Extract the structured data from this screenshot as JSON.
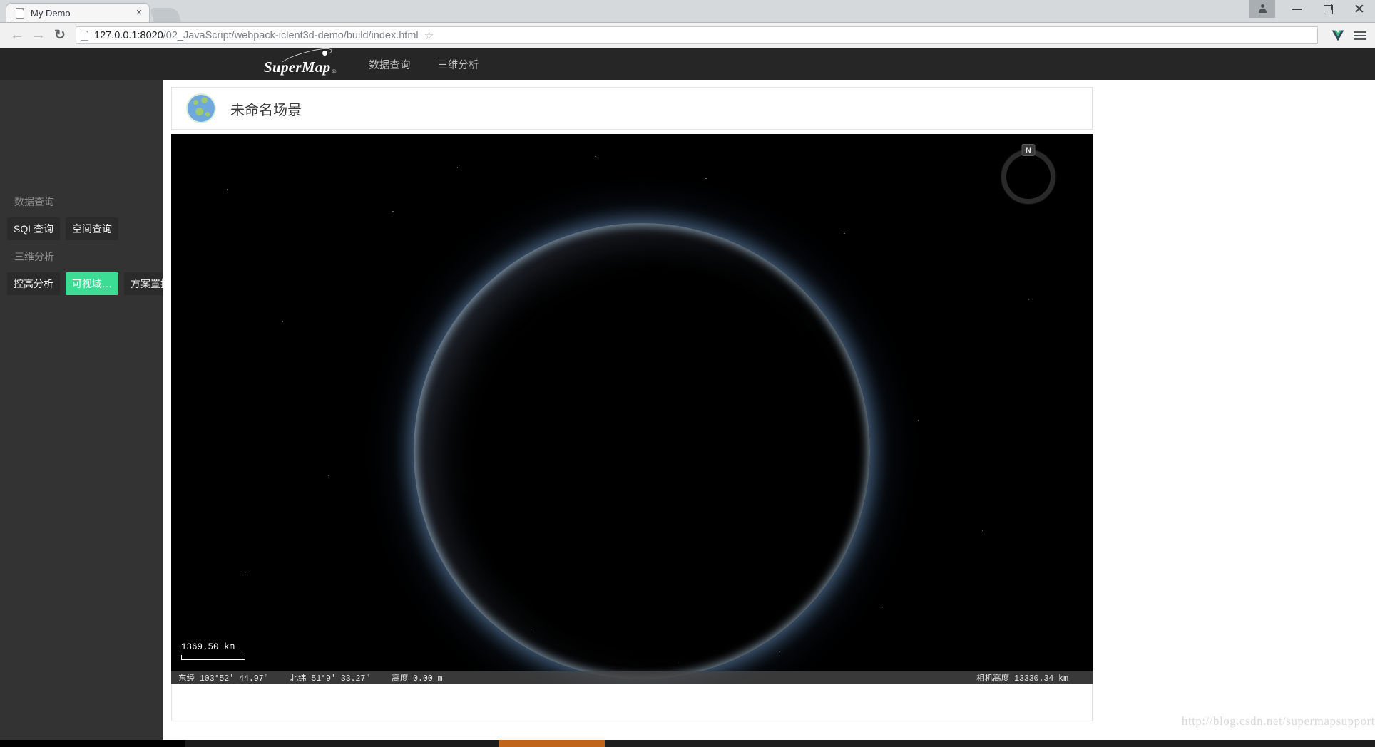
{
  "browser": {
    "tab": {
      "title": "My Demo",
      "close_label": "×",
      "favicon": "page-icon"
    },
    "back_label": "←",
    "forward_label": "→",
    "reload_label": "↻",
    "url": "127.0.0.1:8020/02_JavaScript/webpack-iclent3d-demo/build/index.html",
    "url_host": "127.0.0.1:8020",
    "url_path": "/02_JavaScript/webpack-iclent3d-demo/build/index.html",
    "star_label": "☆",
    "window_controls": {
      "minimize": "—",
      "maximize": "❐",
      "close": "✕"
    }
  },
  "site_header": {
    "logo_text": "SuperMap",
    "logo_sup": "®",
    "nav": [
      {
        "label": "数据查询"
      },
      {
        "label": "三维分析"
      }
    ]
  },
  "sidebar": {
    "groups": [
      {
        "title": "数据查询",
        "buttons": [
          {
            "label": "SQL查询",
            "active": false
          },
          {
            "label": "空间查询",
            "active": false
          }
        ]
      },
      {
        "title": "三维分析",
        "buttons": [
          {
            "label": "控高分析",
            "active": false
          },
          {
            "label": "可视域…",
            "active": true
          },
          {
            "label": "方案置换",
            "active": false
          }
        ]
      }
    ],
    "collapse_left": "‹",
    "collapse_right": "›",
    "active_color": "#3ddc94"
  },
  "scene": {
    "title": "未命名场景",
    "icon": "globe-icon",
    "compass": {
      "north_label": "N"
    },
    "scalebar": {
      "value": "1369.50 km"
    },
    "status": {
      "longitude": "东经 103°52′ 44.97″",
      "latitude": "北纬 51°9′ 33.27″",
      "altitude": "高度 0.00 m",
      "camera_height": "相机高度 13330.34 km"
    }
  },
  "watermark": {
    "text": "http://blog.csdn.net/supermapsupport"
  }
}
